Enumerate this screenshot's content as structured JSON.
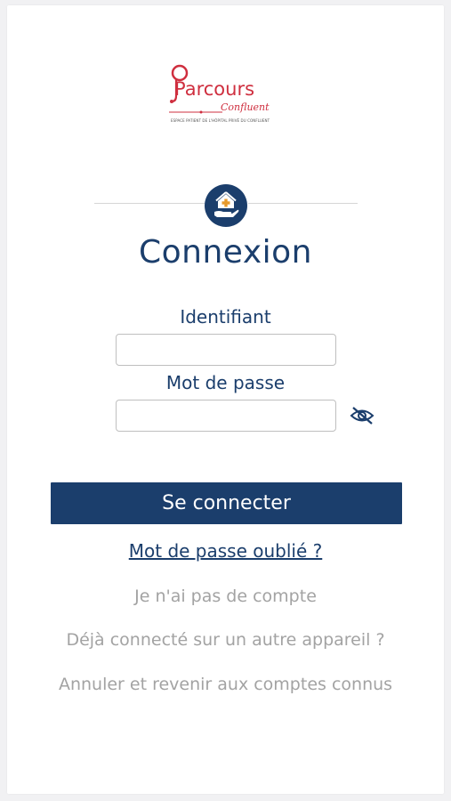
{
  "logo": {
    "word": "Parcours",
    "sub": "Confluent",
    "tagline": "ESPACE PATIENT DE L'HÔPITAL PRIVÉ DU CONFLUENT"
  },
  "page": {
    "title": "Connexion"
  },
  "form": {
    "username_label": "Identifiant",
    "username_value": "",
    "password_label": "Mot de passe",
    "password_value": "",
    "toggle_icon": "eye-slash-icon",
    "submit_label": "Se connecter"
  },
  "links": {
    "forgot_password": "Mot de passe oublié ?",
    "no_account": "Je n'ai pas de compte",
    "other_device": "Déjà connecté sur un autre appareil ?",
    "cancel": "Annuler et revenir aux comptes connus"
  },
  "colors": {
    "brand": "#1b3e6c",
    "logo_red": "#cf2f3f",
    "muted": "#a3a3a3"
  }
}
